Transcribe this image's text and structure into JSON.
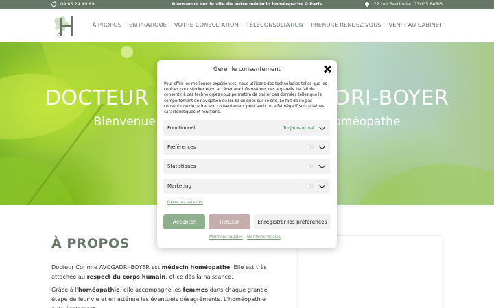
{
  "topbar": {
    "phone": "09 83 24 49 89",
    "welcome": "Bienvenue sur le site de votre médecin homéopathe à Paris",
    "address": "22 rue Berthollet, 75005 PARIS"
  },
  "nav": {
    "items": [
      "À PROPOS",
      "EN PRATIQUE",
      "VOTRE CONSULTATION",
      "TÉLÉCONSULTATION",
      "PRENDRE RENDEZ-VOUS",
      "VENIR AU CABINET"
    ]
  },
  "hero": {
    "title": "DOCTEUR CORINNE AVOGADRI-BOYER",
    "subtitle": "Bienvenue sur le site de votre médecin homéopathe"
  },
  "about": {
    "title": "À PROPOS",
    "p1_a": "Docteur Corinne AVOGADRI-BOYER est ",
    "p1_b": "médecin homéopathe",
    "p1_c": ". Elle est très attachée au ",
    "p1_d": "respect du corps humain",
    "p1_e": ", et ce dès la naissance.",
    "p2_a": "Grâce à l'",
    "p2_b": "homéopathie",
    "p2_c": ", elle accompagne les ",
    "p2_d": "femmes",
    "p2_e": " dans chaque grande étape de leur vie et en atténue les éventuels désagréments. L'homéopathie aide également"
  },
  "consent": {
    "title": "Gérer le consentement",
    "text": "Pour offrir les meilleures expériences, nous utilisons des technologies telles que les cookies pour stocker et/ou accéder aux informations des appareils. Le fait de consentir à ces technologies nous permettra de traiter des données telles que le comportement de navigation ou les ID uniques sur ce site. Le fait de ne pas consentir ou de retirer son consentement peut avoir un effet négatif sur certaines caractéristiques et fonctions.",
    "categories": [
      {
        "label": "Fonctionnel",
        "status": "Toujours activé"
      },
      {
        "label": "Préférences",
        "status": ""
      },
      {
        "label": "Statistiques",
        "status": ""
      },
      {
        "label": "Marketing",
        "status": ""
      }
    ],
    "manage_link": "Gérer les services",
    "accept": "Accepter",
    "refuse": "Refuser",
    "save_prefs": "Enregistrer les préférences",
    "legal1": "Mentions légales",
    "legal2": "Mentions légales"
  },
  "colors": {
    "brand": "#677767",
    "accept": "#8fb08f",
    "refuse": "#c4adaa"
  }
}
